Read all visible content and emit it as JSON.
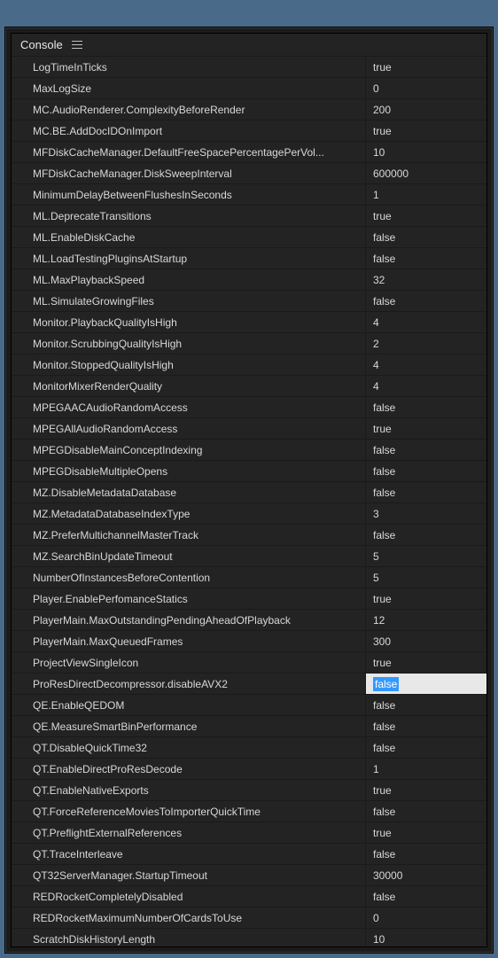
{
  "panel": {
    "title": "Console"
  },
  "rows": [
    {
      "key": "LogTimeInTicks",
      "value": "true"
    },
    {
      "key": "MaxLogSize",
      "value": "0"
    },
    {
      "key": "MC.AudioRenderer.ComplexityBeforeRender",
      "value": "200"
    },
    {
      "key": "MC.BE.AddDocIDOnImport",
      "value": "true"
    },
    {
      "key": "MFDiskCacheManager.DefaultFreeSpacePercentagePerVol...",
      "value": "10"
    },
    {
      "key": "MFDiskCacheManager.DiskSweepInterval",
      "value": "600000"
    },
    {
      "key": "MinimumDelayBetweenFlushesInSeconds",
      "value": "1"
    },
    {
      "key": "ML.DeprecateTransitions",
      "value": "true"
    },
    {
      "key": "ML.EnableDiskCache",
      "value": "false"
    },
    {
      "key": "ML.LoadTestingPluginsAtStartup",
      "value": "false"
    },
    {
      "key": "ML.MaxPlaybackSpeed",
      "value": "32"
    },
    {
      "key": "ML.SimulateGrowingFiles",
      "value": "false"
    },
    {
      "key": "Monitor.PlaybackQualityIsHigh",
      "value": "4"
    },
    {
      "key": "Monitor.ScrubbingQualityIsHigh",
      "value": "2"
    },
    {
      "key": "Monitor.StoppedQualityIsHigh",
      "value": "4"
    },
    {
      "key": "MonitorMixerRenderQuality",
      "value": "4"
    },
    {
      "key": "MPEGAACAudioRandomAccess",
      "value": "false"
    },
    {
      "key": "MPEGAllAudioRandomAccess",
      "value": "true"
    },
    {
      "key": "MPEGDisableMainConceptIndexing",
      "value": "false"
    },
    {
      "key": "MPEGDisableMultipleOpens",
      "value": "false"
    },
    {
      "key": "MZ.DisableMetadataDatabase",
      "value": "false"
    },
    {
      "key": "MZ.MetadataDatabaseIndexType",
      "value": "3"
    },
    {
      "key": "MZ.PreferMultichannelMasterTrack",
      "value": "false"
    },
    {
      "key": "MZ.SearchBinUpdateTimeout",
      "value": "5"
    },
    {
      "key": "NumberOfInstancesBeforeContention",
      "value": "5"
    },
    {
      "key": "Player.EnablePerfomanceStatics",
      "value": "true"
    },
    {
      "key": "PlayerMain.MaxOutstandingPendingAheadOfPlayback",
      "value": "12"
    },
    {
      "key": "PlayerMain.MaxQueuedFrames",
      "value": "300"
    },
    {
      "key": "ProjectViewSingleIcon",
      "value": "true"
    },
    {
      "key": "ProResDirectDecompressor.disableAVX2",
      "value": "false",
      "editing": true
    },
    {
      "key": "QE.EnableQEDOM",
      "value": "false"
    },
    {
      "key": "QE.MeasureSmartBinPerformance",
      "value": "false"
    },
    {
      "key": "QT.DisableQuickTime32",
      "value": "false"
    },
    {
      "key": "QT.EnableDirectProResDecode",
      "value": "1"
    },
    {
      "key": "QT.EnableNativeExports",
      "value": "true"
    },
    {
      "key": "QT.ForceReferenceMoviesToImporterQuickTime",
      "value": "false"
    },
    {
      "key": "QT.PreflightExternalReferences",
      "value": "true"
    },
    {
      "key": "QT.TraceInterleave",
      "value": "false"
    },
    {
      "key": "QT32ServerManager.StartupTimeout",
      "value": "30000"
    },
    {
      "key": "REDRocketCompletelyDisabled",
      "value": "false"
    },
    {
      "key": "REDRocketMaximumNumberOfCardsToUse",
      "value": "0"
    },
    {
      "key": "ScratchDiskHistoryLength",
      "value": "10"
    }
  ]
}
